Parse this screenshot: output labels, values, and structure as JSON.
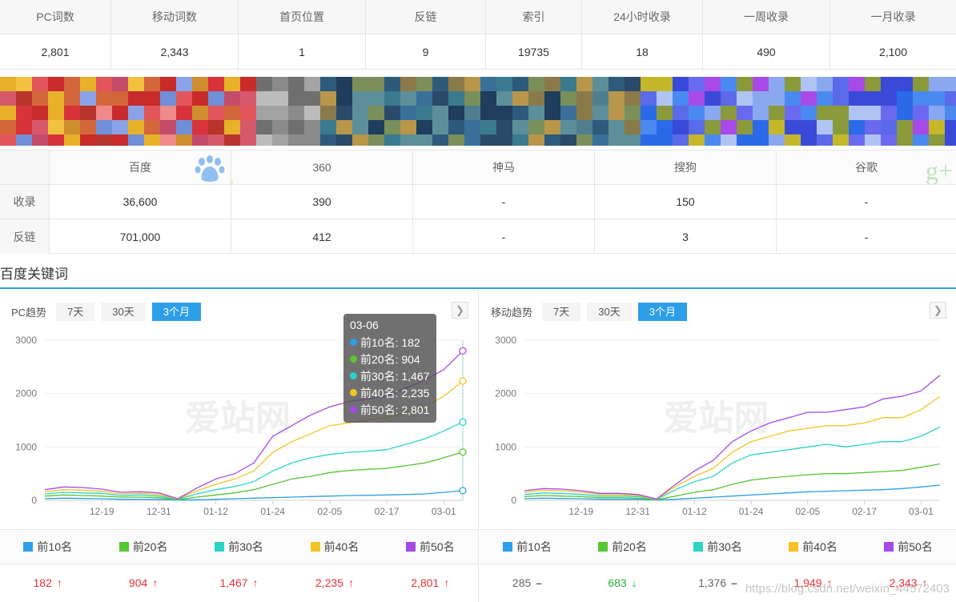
{
  "stats": {
    "headers": [
      "PC词数",
      "移动词数",
      "首页位置",
      "反链",
      "索引",
      "24小时收录",
      "一周收录",
      "一月收录"
    ],
    "values": [
      "2,801",
      "2,343",
      "1",
      "9",
      "19735",
      "18",
      "490",
      "2,100"
    ]
  },
  "engines": {
    "columns": [
      "百度",
      "360",
      "神马",
      "搜狗",
      "谷歌"
    ],
    "logo_icons": [
      "baidu-paw-icon",
      "360-search-icon",
      "shenma-icon",
      "sogou-icon",
      "google-plus-icon"
    ],
    "rows": [
      {
        "label": "收录",
        "values": [
          "36,600",
          "390",
          "-",
          "150",
          "-"
        ]
      },
      {
        "label": "反链",
        "values": [
          "701,000",
          "412",
          "-",
          "3",
          "-"
        ]
      }
    ]
  },
  "section_title": "百度关键词",
  "colors": {
    "accent": "#2d9fe8",
    "series": [
      "#2d9fe8",
      "#56c732",
      "#2dd3c6",
      "#f6c325",
      "#a54ae7"
    ],
    "up": "#e8303a",
    "down": "#2bb534"
  },
  "panels": {
    "pc": {
      "title": "PC趋势",
      "ranges": [
        "7天",
        "30天",
        "3个月"
      ],
      "active_range": "3个月",
      "legend": [
        "前10名",
        "前20名",
        "前30名",
        "前40名",
        "前50名"
      ],
      "values": [
        {
          "text": "182",
          "trend": "up"
        },
        {
          "text": "904",
          "trend": "up"
        },
        {
          "text": "1,467",
          "trend": "up"
        },
        {
          "text": "2,235",
          "trend": "up"
        },
        {
          "text": "2,801",
          "trend": "up"
        }
      ],
      "tooltip": {
        "date": "03-06",
        "rows": [
          "前10名: 182",
          "前20名: 904",
          "前30名: 1,467",
          "前40名: 2,235",
          "前50名: 2,801"
        ]
      },
      "watermark": "爱站网"
    },
    "mobile": {
      "title": "移动趋势",
      "ranges": [
        "7天",
        "30天",
        "3个月"
      ],
      "active_range": "3个月",
      "legend": [
        "前10名",
        "前20名",
        "前30名",
        "前40名",
        "前50名"
      ],
      "values": [
        {
          "text": "285",
          "trend": "flat"
        },
        {
          "text": "683",
          "trend": "down"
        },
        {
          "text": "1,376",
          "trend": "flat"
        },
        {
          "text": "1,949",
          "trend": "up"
        },
        {
          "text": "2,343",
          "trend": "up"
        }
      ],
      "watermark": "爱站网"
    }
  },
  "chart_data": [
    {
      "type": "line",
      "title": "",
      "xlabel": "",
      "ylabel": "",
      "ylim": [
        0,
        3000
      ],
      "yticks": [
        "0",
        "1000",
        "2000",
        "3000"
      ],
      "xticks": [
        "12-19",
        "12-31",
        "01-12",
        "01-24",
        "02-05",
        "02-17",
        "03-01"
      ],
      "x": [
        "12-07",
        "12-11",
        "12-15",
        "12-19",
        "12-23",
        "12-27",
        "12-31",
        "01-04",
        "01-08",
        "01-12",
        "01-16",
        "01-20",
        "01-24",
        "01-28",
        "02-01",
        "02-05",
        "02-09",
        "02-13",
        "02-17",
        "02-21",
        "02-25",
        "03-01",
        "03-06"
      ],
      "series": [
        {
          "name": "前10名",
          "values": [
            30,
            40,
            35,
            30,
            20,
            20,
            18,
            5,
            10,
            20,
            30,
            40,
            50,
            60,
            70,
            80,
            90,
            95,
            100,
            110,
            120,
            150,
            182
          ]
        },
        {
          "name": "前20名",
          "values": [
            80,
            100,
            90,
            80,
            60,
            60,
            50,
            10,
            60,
            100,
            140,
            200,
            300,
            400,
            450,
            520,
            560,
            580,
            600,
            650,
            700,
            800,
            904
          ]
        },
        {
          "name": "前30名",
          "values": [
            120,
            150,
            140,
            130,
            90,
            100,
            80,
            20,
            120,
            200,
            260,
            350,
            550,
            700,
            800,
            860,
            900,
            920,
            950,
            1050,
            1150,
            1300,
            1467
          ]
        },
        {
          "name": "前40名",
          "values": [
            160,
            200,
            190,
            170,
            120,
            130,
            110,
            25,
            180,
            300,
            400,
            550,
            900,
            1100,
            1250,
            1400,
            1450,
            1500,
            1550,
            1650,
            1750,
            1950,
            2235
          ]
        },
        {
          "name": "前50名",
          "values": [
            200,
            250,
            240,
            210,
            150,
            160,
            140,
            30,
            230,
            400,
            500,
            700,
            1200,
            1400,
            1600,
            1750,
            1850,
            1900,
            1950,
            2100,
            2250,
            2450,
            2801
          ]
        }
      ],
      "grid": true,
      "legend": "bottom"
    },
    {
      "type": "line",
      "title": "",
      "xlabel": "",
      "ylabel": "",
      "ylim": [
        0,
        3000
      ],
      "yticks": [
        "0",
        "1000",
        "2000",
        "3000"
      ],
      "xticks": [
        "12-19",
        "12-31",
        "01-12",
        "01-24",
        "02-05",
        "02-17",
        "03-01"
      ],
      "x": [
        "12-07",
        "12-11",
        "12-15",
        "12-19",
        "12-23",
        "12-27",
        "12-31",
        "01-04",
        "01-08",
        "01-12",
        "01-16",
        "01-20",
        "01-24",
        "01-28",
        "02-01",
        "02-05",
        "02-09",
        "02-13",
        "02-17",
        "02-21",
        "02-25",
        "03-01",
        "03-06"
      ],
      "series": [
        {
          "name": "前10名",
          "values": [
            30,
            40,
            35,
            30,
            20,
            20,
            18,
            5,
            20,
            40,
            60,
            80,
            100,
            120,
            140,
            160,
            170,
            180,
            190,
            200,
            220,
            250,
            285
          ]
        },
        {
          "name": "前20名",
          "values": [
            70,
            90,
            80,
            70,
            50,
            50,
            40,
            10,
            80,
            150,
            200,
            300,
            380,
            420,
            450,
            480,
            500,
            500,
            520,
            540,
            560,
            620,
            683
          ]
        },
        {
          "name": "前30名",
          "values": [
            110,
            140,
            130,
            110,
            80,
            80,
            70,
            15,
            200,
            350,
            450,
            700,
            850,
            900,
            950,
            1000,
            1050,
            1000,
            1050,
            1100,
            1100,
            1200,
            1376
          ]
        },
        {
          "name": "前40名",
          "values": [
            150,
            190,
            180,
            150,
            110,
            110,
            90,
            20,
            260,
            450,
            600,
            900,
            1100,
            1200,
            1300,
            1350,
            1400,
            1400,
            1450,
            1550,
            1550,
            1700,
            1949
          ]
        },
        {
          "name": "前50名",
          "values": [
            180,
            220,
            210,
            180,
            130,
            130,
            110,
            25,
            300,
            550,
            750,
            1100,
            1300,
            1450,
            1550,
            1650,
            1650,
            1700,
            1750,
            1900,
            1950,
            2050,
            2343
          ]
        }
      ],
      "grid": true,
      "legend": "bottom"
    }
  ],
  "footer_watermark": "https://blog.csdn.net/weixin_44572403"
}
